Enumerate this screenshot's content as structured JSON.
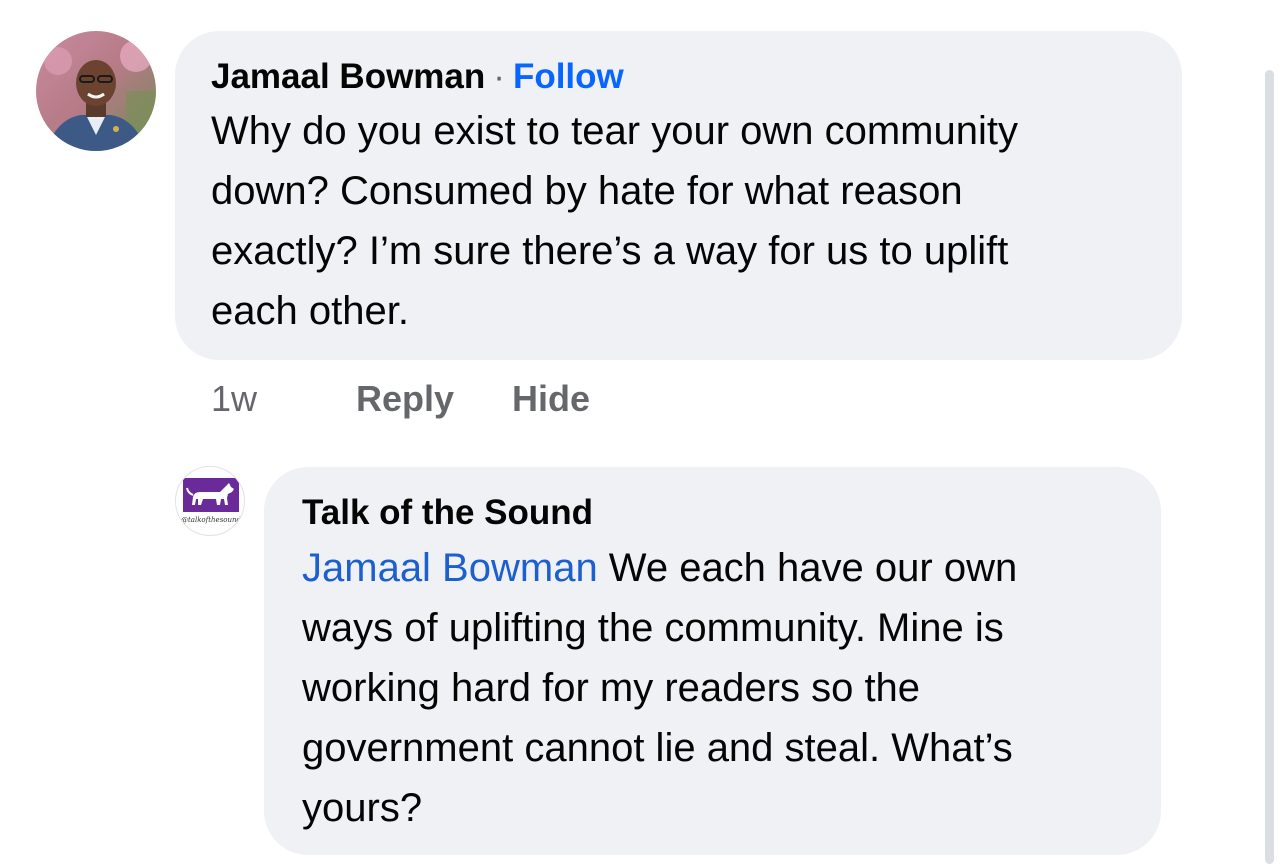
{
  "comment": {
    "author": "Jamaal Bowman",
    "separator": "·",
    "follow_label": "Follow",
    "lines": [
      "Why do you exist to tear your own community",
      "down? Consumed by hate for what reason",
      "exactly? I’m sure there’s a way for us to uplift",
      "each other."
    ],
    "time": "1w",
    "reply_label": "Reply",
    "hide_label": "Hide"
  },
  "reply": {
    "author": "Talk of the Sound",
    "mention": "Jamaal Bowman",
    "first_line_rest": " We each have our own",
    "lines": [
      "ways of uplifting the community. Mine is",
      "working hard for my readers so the",
      "government cannot lie and steal. What’s",
      "yours?"
    ],
    "avatar_caption": "@talkofthesound"
  },
  "colors": {
    "bubble": "#f0f1f5",
    "link": "#0866ff",
    "mention": "#1c5fd1",
    "secondary_text": "#65676b",
    "brand_purple": "#6a2a9a"
  }
}
